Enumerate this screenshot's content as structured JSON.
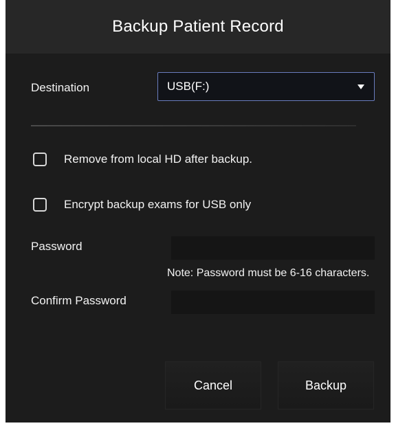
{
  "dialog": {
    "title": "Backup Patient Record"
  },
  "destination": {
    "label": "Destination",
    "selected": "USB(F:)",
    "caret_icon": "triangle-down-icon"
  },
  "options": {
    "remove_local": {
      "label": "Remove from local HD after backup.",
      "checked": false
    },
    "encrypt": {
      "label": "Encrypt backup exams for USB only",
      "checked": false
    }
  },
  "password": {
    "label": "Password",
    "value": "",
    "note": "Note: Password must be 6-16 characters."
  },
  "confirm_password": {
    "label": "Confirm Password",
    "value": ""
  },
  "buttons": {
    "cancel": "Cancel",
    "backup": "Backup"
  },
  "colors": {
    "dialog_background": "#1c1c1c",
    "title_bar_background": "#272727",
    "select_border": "#6a7dbf",
    "text": "#ffffff"
  }
}
